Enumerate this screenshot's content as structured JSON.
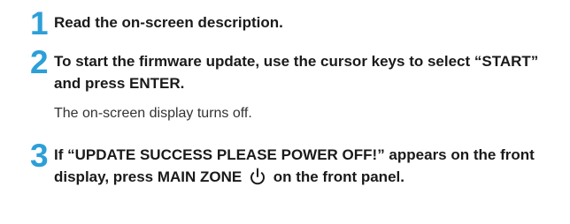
{
  "steps": [
    {
      "number": "1",
      "text": "Read the on-screen description."
    },
    {
      "number": "2",
      "text": "To start the firmware update, use the cursor keys to select “START” and press ENTER.",
      "note": "The on-screen display turns off."
    },
    {
      "number": "3",
      "text_before_icon": "If “UPDATE SUCCESS PLEASE POWER OFF!” appears on the front display, press MAIN ZONE",
      "icon": "power-icon",
      "text_after_icon": "on the front panel."
    }
  ],
  "colors": {
    "step_number": "#2d9fd8",
    "text": "#1a1a1a"
  }
}
